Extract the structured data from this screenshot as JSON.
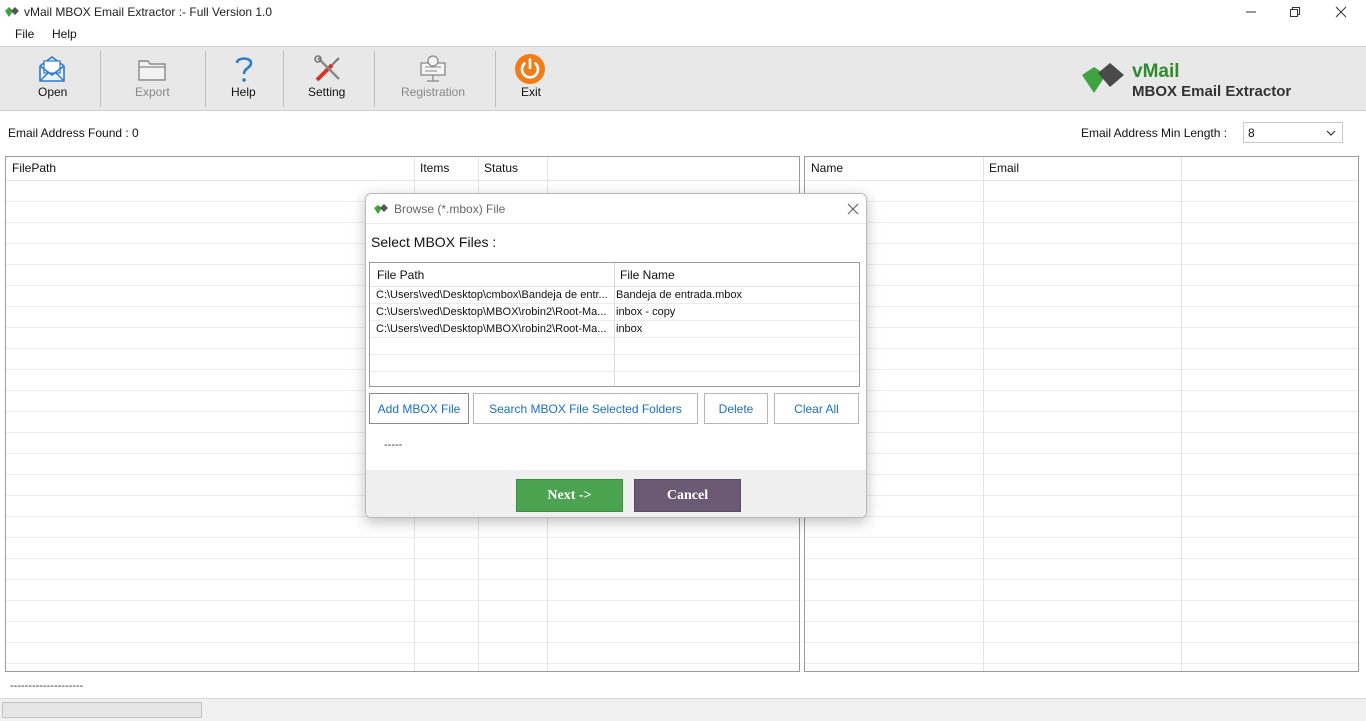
{
  "window": {
    "title": "vMail MBOX Email Extractor :- Full Version 1.0"
  },
  "menu": {
    "items": [
      "File",
      "Help"
    ]
  },
  "toolbar": {
    "buttons": [
      {
        "label": "Open",
        "icon": "open-mail-icon",
        "enabled": true
      },
      {
        "label": "Export",
        "icon": "export-folder-icon",
        "enabled": false
      },
      {
        "label": "Help",
        "icon": "question-mark-icon",
        "enabled": true
      },
      {
        "label": "Setting",
        "icon": "tools-icon",
        "enabled": true
      },
      {
        "label": "Registration",
        "icon": "registration-icon",
        "enabled": false
      },
      {
        "label": "Exit",
        "icon": "power-icon",
        "enabled": true
      }
    ],
    "brand": {
      "name": "vMail",
      "product": "MBOX Email Extractor"
    }
  },
  "info": {
    "found_label": "Email Address Found :  0",
    "min_length_label": "Email Address Min Length :",
    "min_length_value": "8"
  },
  "left_grid": {
    "columns": [
      "FilePath",
      "Items",
      "Status"
    ]
  },
  "right_grid": {
    "columns": [
      "Name",
      "Email"
    ]
  },
  "status": {
    "text": "--------------------"
  },
  "dialog": {
    "title": "Browse (*.mbox) File",
    "heading": "Select MBOX Files :",
    "columns": [
      "File Path",
      "File Name"
    ],
    "rows": [
      {
        "path": "C:\\Users\\ved\\Desktop\\cmbox\\Bandeja de entr...",
        "name": "Bandeja de entrada.mbox"
      },
      {
        "path": "C:\\Users\\ved\\Desktop\\MBOX\\robin2\\Root-Ma...",
        "name": "inbox - copy"
      },
      {
        "path": "C:\\Users\\ved\\Desktop\\MBOX\\robin2\\Root-Ma...",
        "name": "inbox"
      }
    ],
    "buttons": {
      "add": "Add MBOX File",
      "search": "Search MBOX File Selected Folders",
      "delete": "Delete",
      "clear": "Clear All"
    },
    "status_text": "-----",
    "next_label": "Next  ->",
    "cancel_label": "Cancel"
  },
  "colors": {
    "brand_green": "#2e8b2e",
    "next_bg": "#4ba34f",
    "cancel_bg": "#6b5a73",
    "exit_orange": "#f07c1a",
    "link_blue": "#1a6fc4"
  }
}
